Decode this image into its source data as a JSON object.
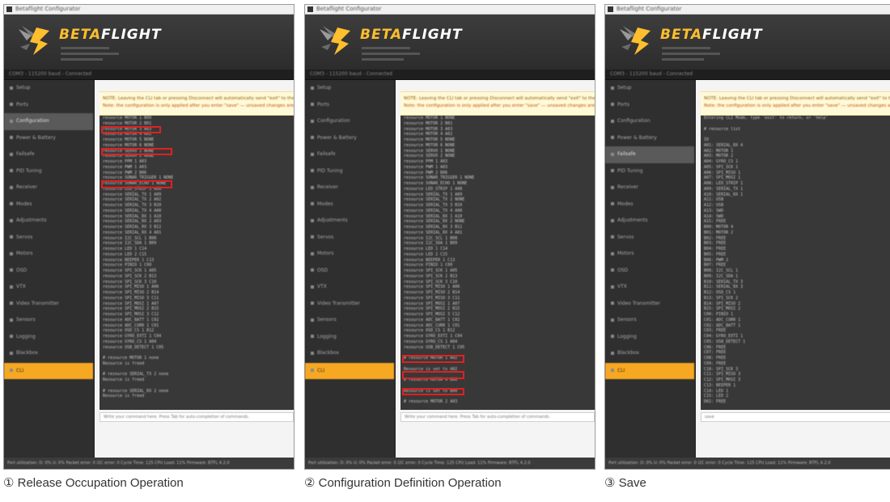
{
  "app": {
    "title": "Betaflight Configurator",
    "logo_prefix": "BETA",
    "logo_suffix": "FLIGHT",
    "sidebar": [
      "Setup",
      "Ports",
      "Configuration",
      "Power & Battery",
      "Failsafe",
      "PID Tuning",
      "Receiver",
      "Modes",
      "Adjustments",
      "Servos",
      "Motors",
      "OSD",
      "VTX",
      "Video Transmitter",
      "Sensors",
      "Logging",
      "Blackbox",
      "CLI"
    ],
    "port_line": "COM3 - 115200 baud - Connected",
    "note_line_1": "NOTE: Leaving the CLI tab or pressing Disconnect will automatically send \"exit\" to the board. This will reboot the flight controller and unsaved changes will be lost.",
    "note_line_2": "Note: the configuration is only applied after you enter \"save\" — unsaved changes are lost when the CLI is closed.",
    "status_line": "Port utilization: D: 0% U: 0%   Packet error: 0   I2C error: 0   Cycle Time: 125   CPU Load: 11%   Firmware: BTFL 4.2.0"
  },
  "panels": [
    {
      "id": "release",
      "caption": "① Release Occupation Operation",
      "active_tab": 2,
      "cmd": "Write your command here. Press Tab for auto-completion of commands.",
      "lines": [
        "resource MOTOR 1 B00",
        "resource MOTOR 2 B01",
        "resource MOTOR 3 A03",
        "resource MOTOR 4 A02",
        "resource MOTOR 5 NONE",
        "resource MOTOR 6 NONE",
        "resource SERVO 1 NONE",
        "resource SERVO 2 NONE",
        "resource PPM 1 A03",
        "resource PWM 1 A03",
        "resource PWM 2 B06",
        "resource SONAR_TRIGGER 1 NONE",
        "resource SONAR_ECHO 1 NONE",
        "resource LED_STRIP 1 A08",
        "resource SERIAL_TX 1 A09",
        "resource SERIAL_TX 2 A02",
        "resource SERIAL_TX 3 B10",
        "resource SERIAL_TX 4 A00",
        "resource SERIAL_RX 1 A10",
        "resource SERIAL_RX 2 A03",
        "resource SERIAL_RX 3 B11",
        "resource SERIAL_RX 4 A01",
        "resource I2C_SCL 1 B08",
        "resource I2C_SDA 1 B09",
        "resource LED 1 C14",
        "resource LED 2 C15",
        "resource BEEPER 1 C13",
        "resource PINIO 1 C00",
        "resource SPI_SCK 1 A05",
        "resource SPI_SCK 2 B13",
        "resource SPI_SCK 3 C10",
        "resource SPI_MISO 1 A06",
        "resource SPI_MISO 2 B14",
        "resource SPI_MISO 3 C11",
        "resource SPI_MOSI 1 A07",
        "resource SPI_MOSI 2 B15",
        "resource SPI_MOSI 3 C12",
        "resource ADC_BATT 1 C02",
        "resource ADC_CURR 1 C01",
        "resource OSD_CS 1 B12",
        "resource GYRO_EXTI 1 C04",
        "resource GYRO_CS 1 A04",
        "resource USB_DETECT 1 C05",
        "",
        "# resource MOTOR 1 none",
        "Resource is freed",
        "",
        "# resource SERIAL_TX 2 none",
        "Resource is freed",
        "",
        "# resource SERIAL_RX 2 none",
        "Resource is freed"
      ]
    },
    {
      "id": "config",
      "caption": "② Configuration Definition Operation",
      "active_tab": -1,
      "cmd": "Write your command here. Press Tab for auto-completion of commands.",
      "lines": [
        "resource MOTOR 1 NONE",
        "resource MOTOR 2 B01",
        "resource MOTOR 3 A03",
        "resource MOTOR 4 A02",
        "resource MOTOR 5 NONE",
        "resource MOTOR 6 NONE",
        "resource SERVO 1 NONE",
        "resource SERVO 2 NONE",
        "resource PPM 1 A03",
        "resource PWM 1 A03",
        "resource PWM 2 B06",
        "resource SONAR_TRIGGER 1 NONE",
        "resource SONAR_ECHO 1 NONE",
        "resource LED_STRIP 1 A08",
        "resource SERIAL_TX 1 A09",
        "resource SERIAL_TX 2 NONE",
        "resource SERIAL_TX 3 B10",
        "resource SERIAL_TX 4 A00",
        "resource SERIAL_RX 1 A10",
        "resource SERIAL_RX 2 NONE",
        "resource SERIAL_RX 3 B11",
        "resource SERIAL_RX 4 A01",
        "resource I2C_SCL 1 B08",
        "resource I2C_SDA 1 B09",
        "resource LED 1 C14",
        "resource LED 2 C15",
        "resource BEEPER 1 C13",
        "resource PINIO 1 C00",
        "resource SPI_SCK 1 A05",
        "resource SPI_SCK 2 B13",
        "resource SPI_SCK 3 C10",
        "resource SPI_MISO 1 A06",
        "resource SPI_MISO 2 B14",
        "resource SPI_MISO 3 C11",
        "resource SPI_MOSI 1 A07",
        "resource SPI_MOSI 2 B15",
        "resource SPI_MOSI 3 C12",
        "resource ADC_BATT 1 C02",
        "resource ADC_CURR 1 C01",
        "resource OSD_CS 1 B12",
        "resource GYRO_EXTI 1 C04",
        "resource GYRO_CS 1 A04",
        "resource USB_DETECT 1 C05",
        "",
        "# resource MOTOR 1 A02",
        "",
        "Resource is set to A02",
        "",
        "# resource MOTOR 4 B00",
        "",
        "Resource is set to B00",
        "",
        "# resource MOTOR 2 A03",
        "",
        "Resource is set to A03"
      ]
    },
    {
      "id": "save",
      "caption": "③ Save",
      "active_tab": 4,
      "cmd": "save",
      "lines": [
        "Entering CLI Mode, type 'exit' to return, or 'help'",
        "",
        "# resource list",
        "",
        "IO",
        "A01: SERIAL_RX 4",
        "A02: MOTOR 1",
        "A03: MOTOR 2",
        "A04: GYRO_CS 1",
        "A05: SPI_SCK 1",
        "A06: SPI_MISO 1",
        "A07: SPI_MOSI 1",
        "A08: LED_STRIP 1",
        "A09: SERIAL_TX 1",
        "A10: SERIAL_RX 1",
        "A11: USB",
        "A12: USB",
        "A13: SWD",
        "A14: SWD",
        "A15: FREE",
        "B00: MOTOR 4",
        "B01: MOTOR 2",
        "B02: FREE",
        "B03: FREE",
        "B04: FREE",
        "B05: FREE",
        "B06: PWM 2",
        "B07: FREE",
        "B08: I2C_SCL 1",
        "B09: I2C_SDA 1",
        "B10: SERIAL_TX 3",
        "B11: SERIAL_RX 3",
        "B12: OSD_CS 1",
        "B13: SPI_SCK 2",
        "B14: SPI_MISO 2",
        "B15: SPI_MOSI 2",
        "C00: PINIO 1",
        "C01: ADC_CURR 1",
        "C02: ADC_BATT 1",
        "C03: FREE",
        "C04: GYRO_EXTI 1",
        "C05: USB_DETECT 1",
        "C06: FREE",
        "C07: FREE",
        "C08: FREE",
        "C09: FREE",
        "C10: SPI_SCK 3",
        "C11: SPI_MISO 3",
        "C12: SPI_MOSI 3",
        "C13: BEEPER 1",
        "C14: LED 1",
        "C15: LED 2",
        "D02: FREE"
      ]
    }
  ]
}
